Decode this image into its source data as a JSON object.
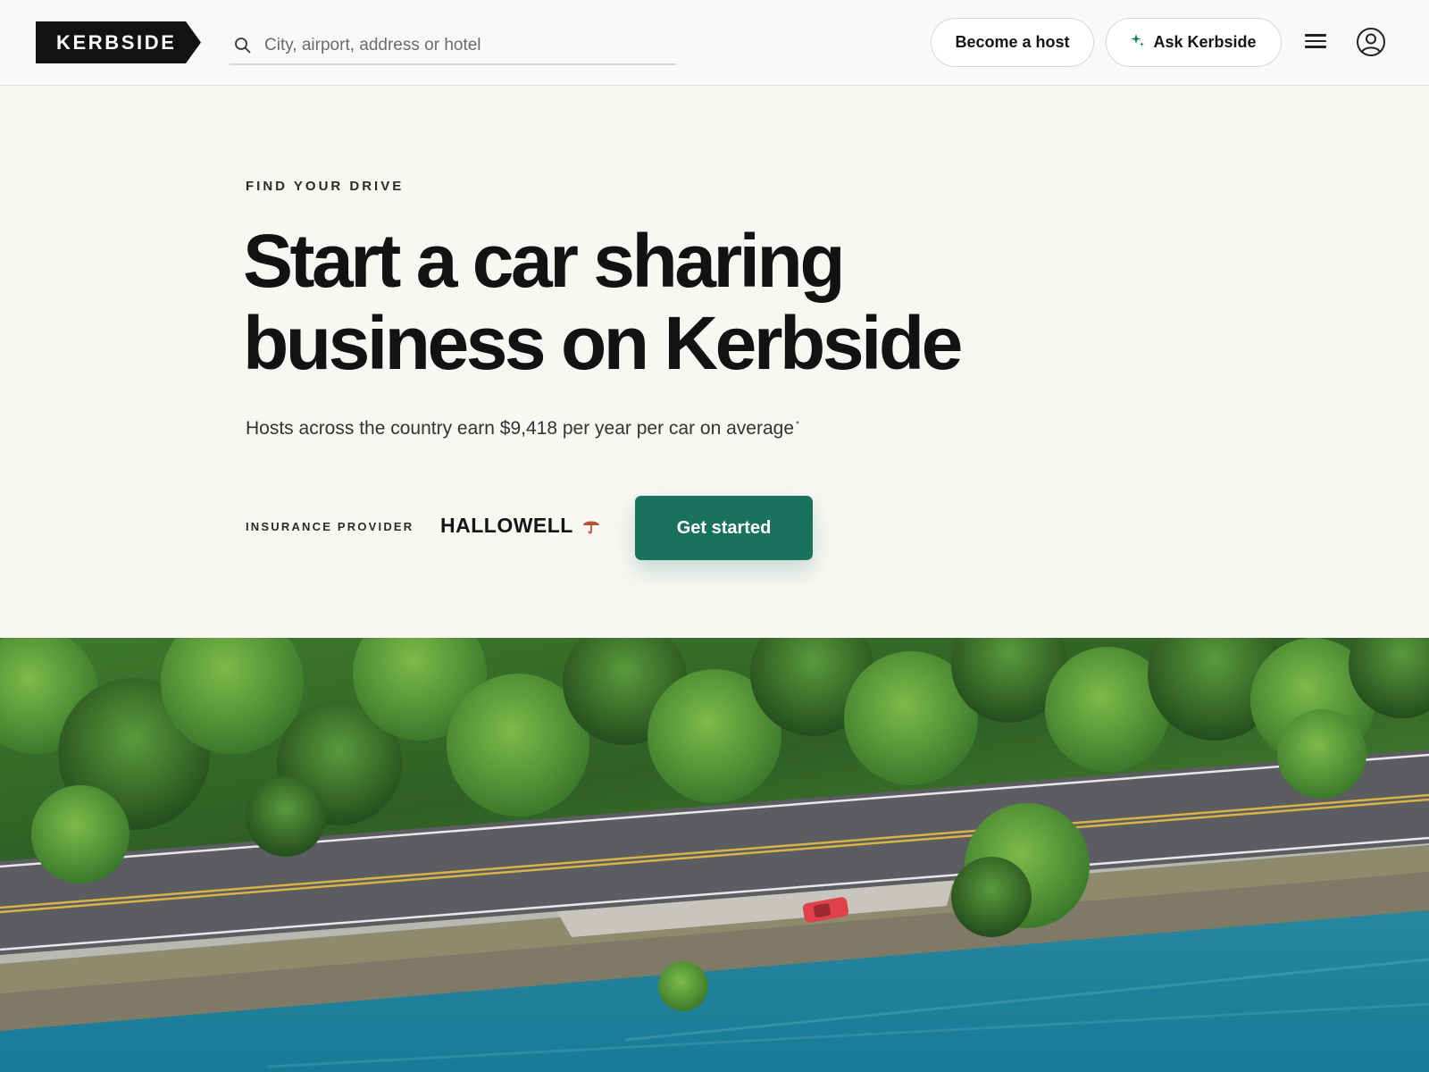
{
  "header": {
    "logo_text": "KERBSIDE",
    "search_placeholder": "City, airport, address or hotel",
    "become_host_label": "Become a host",
    "ask_label": "Ask Kerbside"
  },
  "hero": {
    "eyebrow": "FIND YOUR DRIVE",
    "headline_line1": "Start a car sharing",
    "headline_line2": "business on Kerbside",
    "subtext": "Hosts across the country earn $9,418 per year per car on average",
    "footnote_marker": "*",
    "insurance_label": "INSURANCE PROVIDER",
    "insurance_brand": "HALLOWELL",
    "cta_label": "Get started"
  },
  "colors": {
    "brand_dark": "#121212",
    "accent_green": "#1a715d",
    "insurance_umbrella": "#b4553a"
  },
  "icons": [
    "search-icon",
    "sparkle-icon",
    "hamburger-menu-icon",
    "account-icon",
    "umbrella-icon"
  ]
}
